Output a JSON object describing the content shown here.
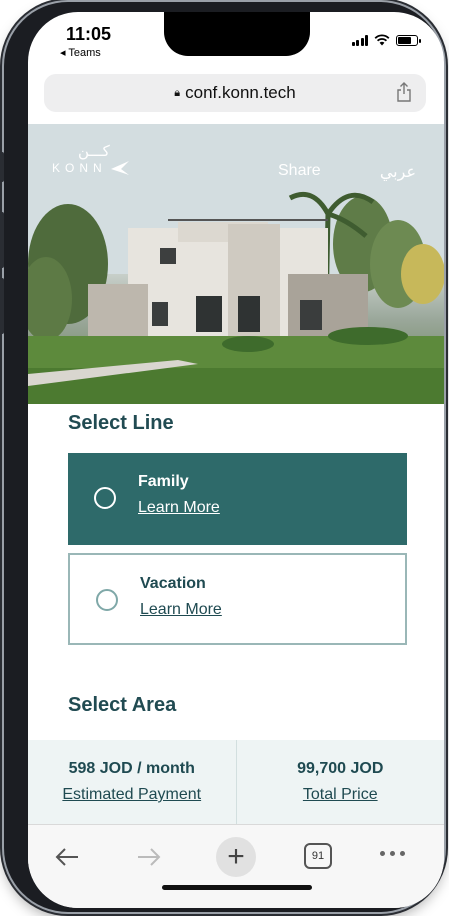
{
  "status": {
    "time": "11:05",
    "back_app": "◂ Teams"
  },
  "browser": {
    "url": "conf.konn.tech",
    "tab_count": "91"
  },
  "hero": {
    "logo_ar": "كـــن",
    "logo_en": "KONN",
    "share_label": "Share",
    "lang_label": "عربي"
  },
  "select_line": {
    "title": "Select Line",
    "options": [
      {
        "name": "Family",
        "link": "Learn More",
        "selected": true
      },
      {
        "name": "Vacation",
        "link": "Learn More",
        "selected": false
      }
    ]
  },
  "select_area": {
    "title": "Select Area"
  },
  "pricing": {
    "monthly_value": "598 JOD / month",
    "monthly_label": "Estimated Payment",
    "total_value": "99,700 JOD",
    "total_label": "Total Price"
  },
  "colors": {
    "brand_teal": "#2e6a6a",
    "heading": "#214b52",
    "price_bg": "#eef4f4"
  },
  "icons": [
    "lock-icon",
    "share-icon",
    "back-arrow-icon",
    "forward-arrow-icon",
    "new-tab-icon",
    "tabs-icon",
    "more-icon"
  ]
}
